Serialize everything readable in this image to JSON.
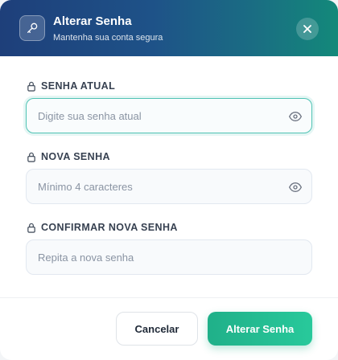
{
  "dialog": {
    "title": "Alterar Senha",
    "subtitle": "Mantenha sua conta segura",
    "header_icon": "key-icon",
    "close_icon": "close-icon"
  },
  "fields": {
    "current": {
      "label": "SENHA ATUAL",
      "placeholder": "Digite sua senha atual",
      "value": "",
      "icon": "lock-icon",
      "toggle_icon": "eye-icon"
    },
    "new": {
      "label": "NOVA SENHA",
      "placeholder": "Mínimo 4 caracteres",
      "value": "",
      "icon": "lock-icon",
      "toggle_icon": "eye-icon"
    },
    "confirm": {
      "label": "CONFIRMAR NOVA SENHA",
      "placeholder": "Repita a nova senha",
      "value": "",
      "icon": "lock-icon"
    }
  },
  "actions": {
    "cancel_label": "Cancelar",
    "submit_label": "Alterar Senha"
  },
  "colors": {
    "header_start": "#1e3f7a",
    "header_end": "#13897a",
    "accent": "#20b089",
    "focus_border": "#4fc3b4"
  }
}
